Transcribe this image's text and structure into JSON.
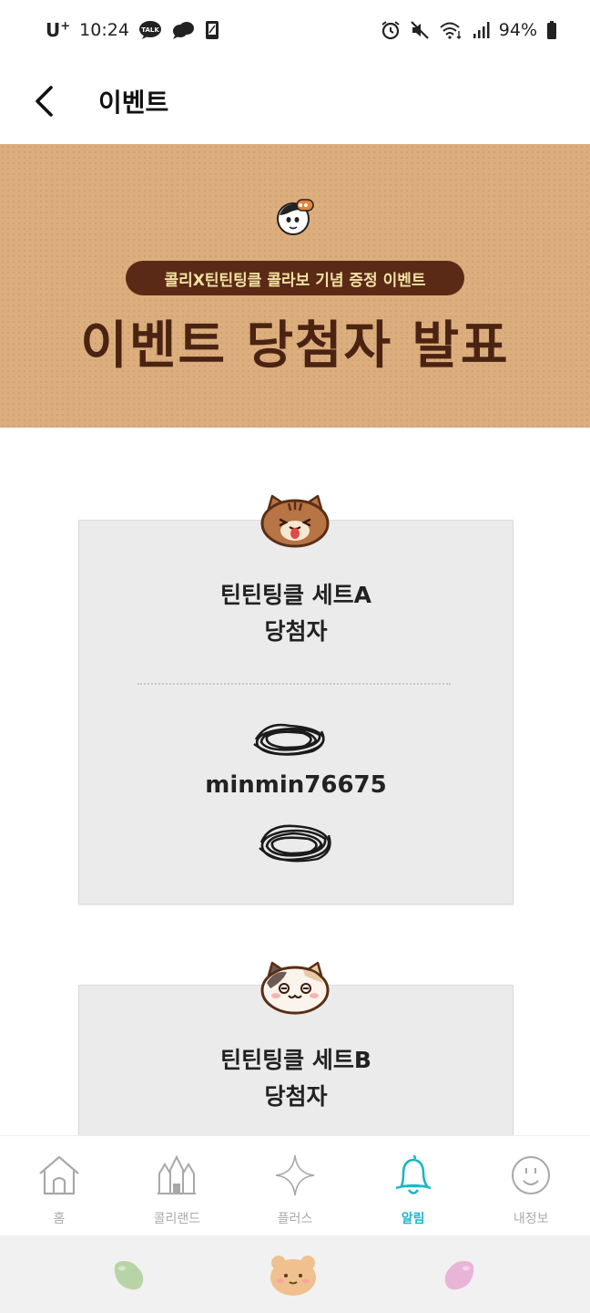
{
  "status_bar": {
    "carrier": "U",
    "carrier_sup": "+",
    "time": "10:24",
    "talk_badge": "TALK",
    "battery": "94%"
  },
  "header": {
    "title": "이벤트"
  },
  "banner": {
    "subtitle": "콜리X틴틴팅클 콜라보 기념 증정 이벤트",
    "title": "이벤트 당첨자 발표"
  },
  "cards": [
    {
      "title_line1": "틴틴팅클 세트A",
      "title_line2": "당첨자",
      "winner_visible": "minmin76675"
    },
    {
      "title_line1": "틴틴팅클 세트B",
      "title_line2": "당첨자"
    }
  ],
  "bottom_nav": {
    "items": [
      {
        "label": "홈",
        "icon": "home-icon"
      },
      {
        "label": "콜리랜드",
        "icon": "castle-icon"
      },
      {
        "label": "플러스",
        "icon": "sparkle-icon"
      },
      {
        "label": "알림",
        "icon": "bell-icon",
        "active": true
      },
      {
        "label": "내정보",
        "icon": "smile-icon"
      }
    ],
    "active_color": "#1ab8c4"
  },
  "colors": {
    "banner_bg": "#dcae7e",
    "banner_title": "#4a2312",
    "pill_bg": "#5b2a17",
    "pill_text": "#f3e2a2",
    "card_bg": "#ebebeb"
  }
}
